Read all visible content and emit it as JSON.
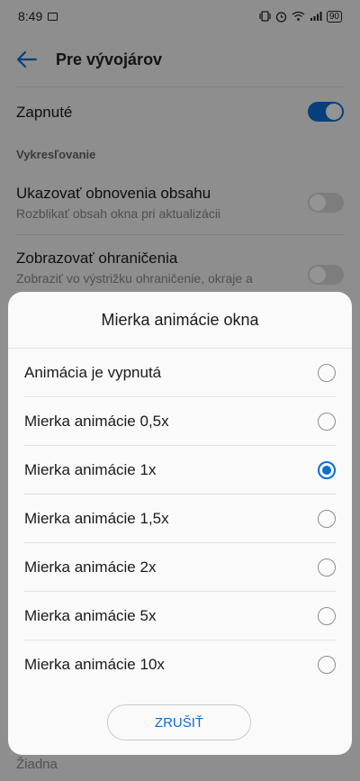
{
  "status_bar": {
    "time": "8:49",
    "battery": "90"
  },
  "app_bar": {
    "title": "Pre vývojárov"
  },
  "settings": {
    "master_toggle_label": "Zapnuté",
    "master_toggle_on": true,
    "section_header": "Vykresľovanie",
    "items": [
      {
        "title": "Ukazovať obnovenia obsahu",
        "subtitle": "Rozblikať obsah okna pri aktualizácii",
        "on": false
      },
      {
        "title": "Zobrazovať ohraničenia",
        "subtitle": "Zobraziť vo výstrižku ohraničenie, okraje a",
        "on": false
      }
    ],
    "bottom_value": "Žiadna"
  },
  "dialog": {
    "title": "Mierka animácie okna",
    "options": [
      {
        "label": "Animácia je vypnutá",
        "checked": false
      },
      {
        "label": "Mierka animácie 0,5x",
        "checked": false
      },
      {
        "label": "Mierka animácie 1x",
        "checked": true
      },
      {
        "label": "Mierka animácie 1,5x",
        "checked": false
      },
      {
        "label": "Mierka animácie 2x",
        "checked": false
      },
      {
        "label": "Mierka animácie 5x",
        "checked": false
      },
      {
        "label": "Mierka animácie 10x",
        "checked": false
      }
    ],
    "cancel_label": "ZRUŠIŤ"
  },
  "colors": {
    "accent": "#0a6fd6"
  }
}
